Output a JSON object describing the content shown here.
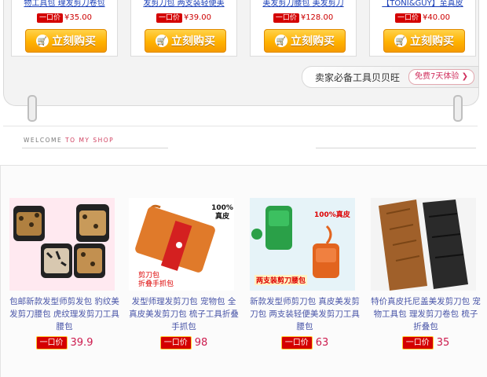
{
  "top_cards": [
    {
      "name": "物工具包 理发剪刀卷包",
      "tag": "一口价",
      "price": "¥35.00",
      "buy_label": "立刻购买"
    },
    {
      "name": "发剪刀包 两支装轻便美",
      "tag": "一口价",
      "price": "¥39.00",
      "buy_label": "立刻购买"
    },
    {
      "name": "美发剪刀腰包 美发剪刀",
      "tag": "一口价",
      "price": "¥128.00",
      "buy_label": "立刻购买"
    },
    {
      "name": "【TONI&GUY】至真皮",
      "tag": "一口价",
      "price": "¥40.00",
      "buy_label": "立刻购买"
    }
  ],
  "seller_bar": {
    "text": "卖家必备工具贝贝旺",
    "trial": "免费7天体验 ❯"
  },
  "welcome": {
    "part1": "WELCOME",
    "part2": "TO MY SHOP"
  },
  "products": [
    {
      "desc": "包邮新款发型师剪发包 豹纹美发剪刀腰包 虎纹理发剪刀工具腰包",
      "tag": "一口价",
      "price": "39.9"
    },
    {
      "desc": "发型师理发剪刀包 宠物包 全真皮美发剪刀包 梳子工具折叠手抓包",
      "tag": "一口价",
      "price": "98"
    },
    {
      "desc": "新款发型师剪刀包 真皮美发剪刀包 两支装轻便美发剪刀工具腰包",
      "tag": "一口价",
      "price": "63"
    },
    {
      "desc": "特价真皮托尼盖美发剪刀包 宠物工具包 理发剪刀卷包 梳子折叠包",
      "tag": "一口价",
      "price": "35"
    }
  ],
  "image_labels": {
    "p2_badge": "100% 真皮",
    "p2_caption1": "剪刀包",
    "p2_caption2": "折叠手抓包",
    "p3_badge": "100%真皮",
    "p3_caption": "两支装剪刀腰包"
  }
}
